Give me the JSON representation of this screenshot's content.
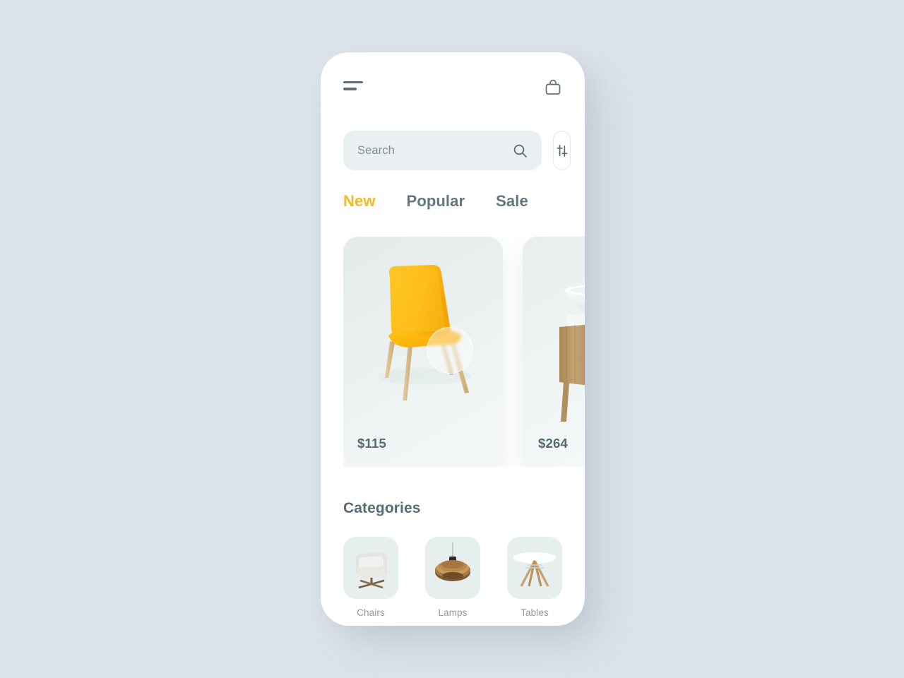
{
  "app": {
    "background_color": "#dde3ea",
    "accent_color": "#f9b823",
    "text_color": "#566d75"
  },
  "header": {
    "menu_icon": "hamburger-menu-icon",
    "cart_icon": "shopping-bag-icon"
  },
  "search": {
    "value": "",
    "placeholder": "Search",
    "search_icon": "magnifier-icon",
    "filter_icon": "sliders-filter-icon"
  },
  "tabs": [
    {
      "label": "New",
      "active": true
    },
    {
      "label": "Popular",
      "active": false
    },
    {
      "label": "Sale",
      "active": false
    }
  ],
  "products": [
    {
      "price": "$115",
      "item": "yellow-chair",
      "action_icon": "add-button-circle"
    },
    {
      "price": "$264",
      "item": "wooden-vanity-sink"
    }
  ],
  "categories": {
    "title": "Categories",
    "items": [
      {
        "label": "Chairs",
        "icon": "armchair-thumbnail"
      },
      {
        "label": "Lamps",
        "icon": "pendant-lamp-thumbnail"
      },
      {
        "label": "Tables",
        "icon": "round-table-thumbnail"
      }
    ]
  }
}
